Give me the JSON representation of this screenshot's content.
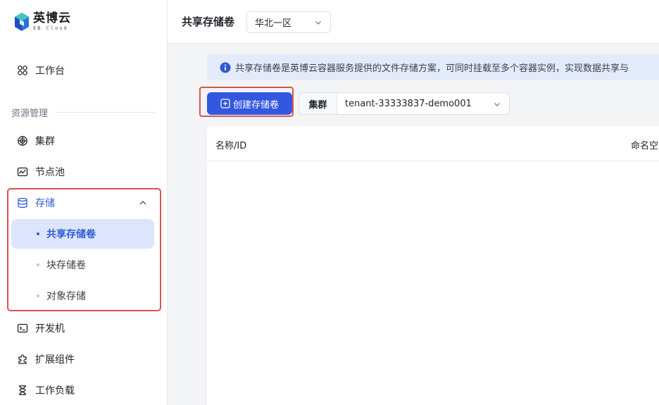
{
  "logo": {
    "name": "英博云",
    "sub": "EB Cloud"
  },
  "sidebar": {
    "workbench": "工作台",
    "section_resources": "资源管理",
    "cluster": "集群",
    "node_pool": "节点池",
    "storage": {
      "label": "存储",
      "items": [
        "共享存储卷",
        "块存储卷",
        "对象存储"
      ]
    },
    "dev_machine": "开发机",
    "extensions": "扩展组件",
    "workloads": "工作负载"
  },
  "header": {
    "title": "共享存储卷",
    "region": "华北一区"
  },
  "main": {
    "info": "共享存储卷是英博云容器服务提供的文件存储方案，可同时挂载至多个容器实例，实现数据共享与",
    "create_label": "创建存储卷",
    "cluster_label": "集群",
    "cluster_value": "tenant-33333837-demo001",
    "table_headers": [
      "名称/ID",
      "命名空"
    ]
  },
  "colors": {
    "accent": "#3358e0",
    "highlight": "#d9534f",
    "active_bg": "#dce5fb"
  }
}
